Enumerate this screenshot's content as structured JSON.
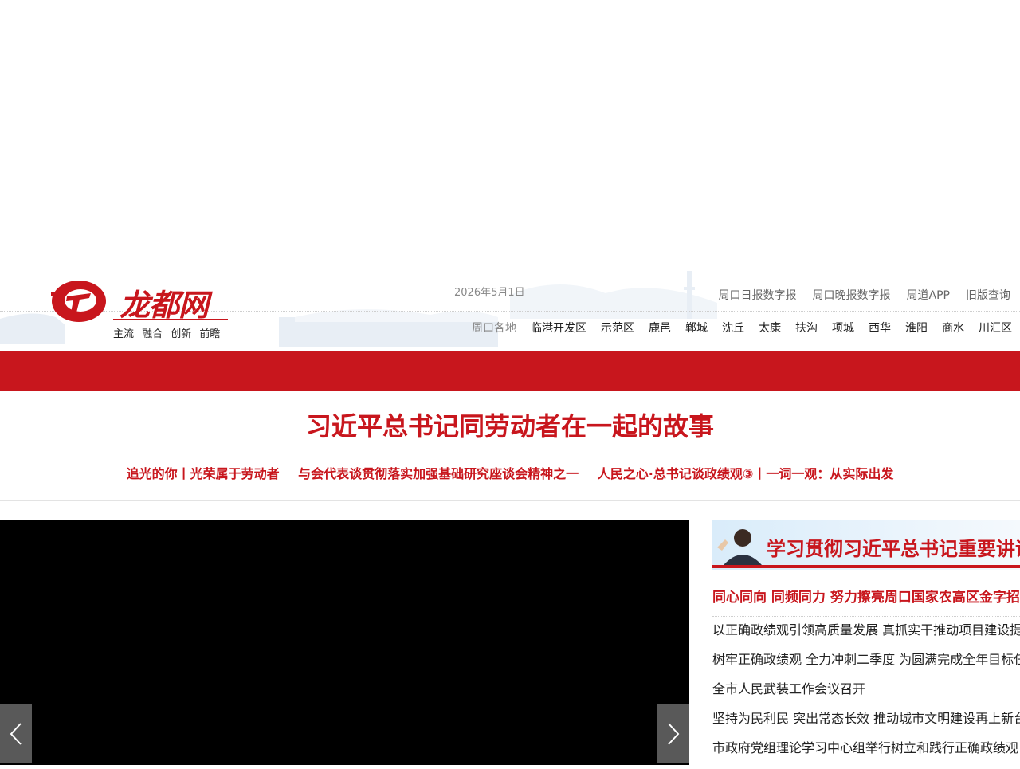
{
  "header": {
    "logo_text": "龙都网",
    "slogan": "主流 融合 创新 前瞻",
    "date": "2026年5月1日",
    "top_links": [
      "周口日报数字报",
      "周口晚报数字报",
      "周道APP",
      "旧版查询"
    ],
    "region_label": "周口各地",
    "regions": [
      "临港开发区",
      "示范区",
      "鹿邑",
      "郸城",
      "沈丘",
      "太康",
      "扶沟",
      "项城",
      "西华",
      "淮阳",
      "商水",
      "川汇区"
    ]
  },
  "headline": {
    "title": "习近平总书记同劳动者在一起的故事",
    "links": [
      "追光的你丨光荣属于劳动者",
      "与会代表谈贯彻落实加强基础研究座谈会精神之一",
      "人民之心·总书记谈政绩观③丨一词一观：从实际出发"
    ]
  },
  "slider": {
    "prev_icon": "chevron-left-icon",
    "next_icon": "chevron-right-icon"
  },
  "right": {
    "banner_text": "学习贯彻习近平总书记重要讲话精神",
    "lead": "同心同向 同频同力 努力擦亮周口国家农高区金字招牌",
    "news": [
      "以正确政绩观引领高质量发展 真抓实干推动项目建设提质增效",
      "树牢正确政绩观 全力冲刺二季度 为圆满完成全年目标任务",
      "全市人民武装工作会议召开",
      "坚持为民利民 突出常态长效 推动城市文明建设再上新台阶",
      "市政府党组理论学习中心组举行树立和践行正确政绩观"
    ]
  },
  "colors": {
    "brand_red": "#c8161d"
  }
}
